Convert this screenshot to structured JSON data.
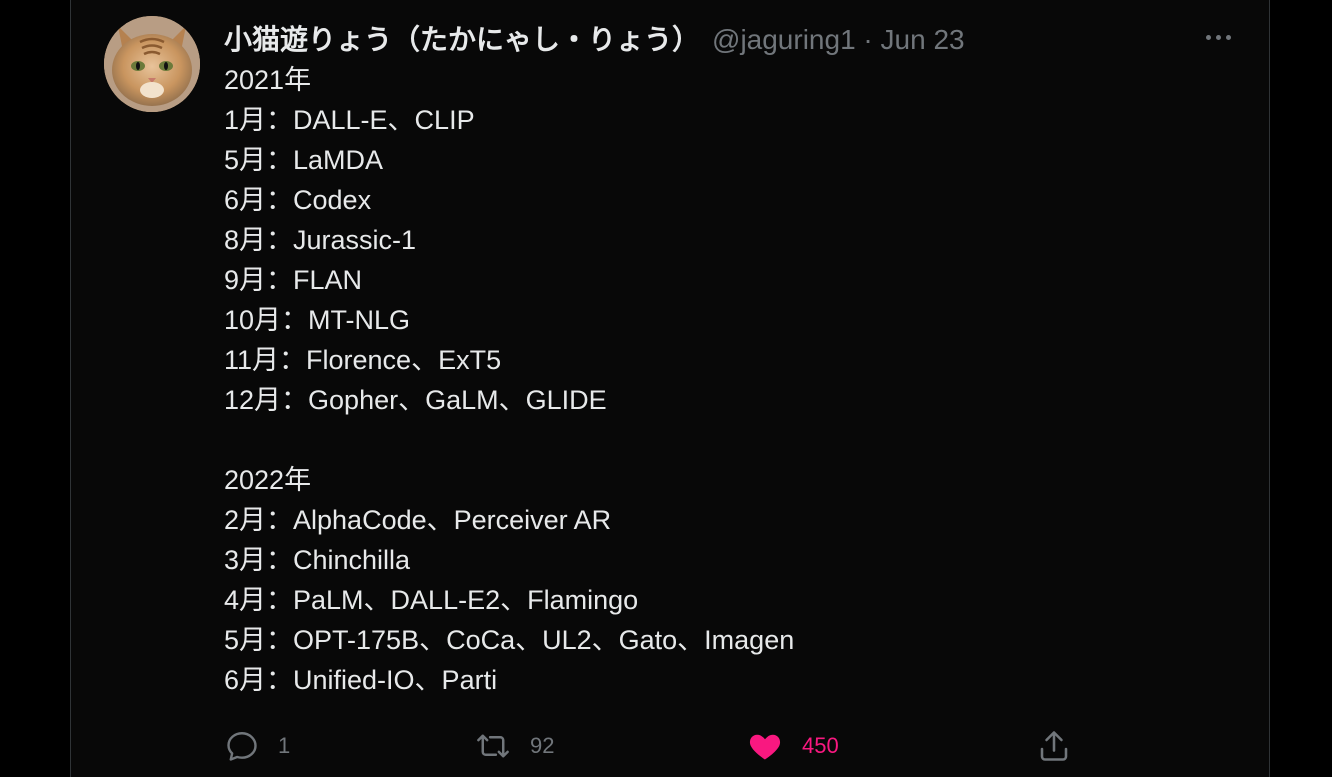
{
  "tweet": {
    "display_name": "小猫遊りょう（たかにゃし・りょう）",
    "handle": "@jaguring1",
    "separator": "·",
    "date": "Jun 23",
    "lines": [
      "2021年",
      "1月：DALL-E、CLIP",
      "5月：LaMDA",
      "6月：Codex",
      "8月：Jurassic-1",
      "9月：FLAN",
      "10月：MT-NLG",
      "11月：Florence、ExT5",
      "12月：Gopher、GaLM、GLIDE",
      "",
      "2022年",
      "2月：AlphaCode、Perceiver AR",
      "3月：Chinchilla",
      "4月：PaLM、DALL-E2、Flamingo",
      "5月：OPT-175B、CoCa、UL2、Gato、Imagen",
      "6月：Unified-IO、Parti"
    ]
  },
  "actions": {
    "reply_count": "1",
    "retweet_count": "92",
    "like_count": "450"
  },
  "icons": {
    "reply": "reply-icon",
    "retweet": "retweet-icon",
    "like": "heart-icon",
    "share": "share-icon",
    "more": "more-icon"
  },
  "colors": {
    "background": "#000000",
    "text": "#e7e9ea",
    "muted": "#71767b",
    "like": "#f91880"
  }
}
